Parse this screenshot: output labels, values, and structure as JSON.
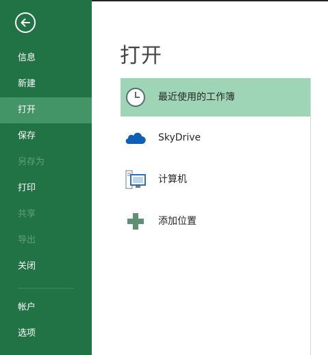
{
  "sidebar": {
    "items": [
      {
        "label": "信息"
      },
      {
        "label": "新建"
      },
      {
        "label": "打开"
      },
      {
        "label": "保存"
      },
      {
        "label": "另存为"
      },
      {
        "label": "打印"
      },
      {
        "label": "共享"
      },
      {
        "label": "导出"
      },
      {
        "label": "关闭"
      },
      {
        "label": "帐户"
      },
      {
        "label": "选项"
      }
    ]
  },
  "main": {
    "title": "打开",
    "places": [
      {
        "label": "最近使用的工作簿",
        "icon": "clock-icon",
        "selected": true
      },
      {
        "label": "SkyDrive",
        "icon": "cloud-icon"
      },
      {
        "label": "计算机",
        "icon": "computer-icon"
      },
      {
        "label": "添加位置",
        "icon": "plus-icon"
      }
    ]
  },
  "colors": {
    "sidebar_bg": "#217346",
    "sidebar_active": "#439467",
    "selected_item": "#9fd5b7"
  }
}
